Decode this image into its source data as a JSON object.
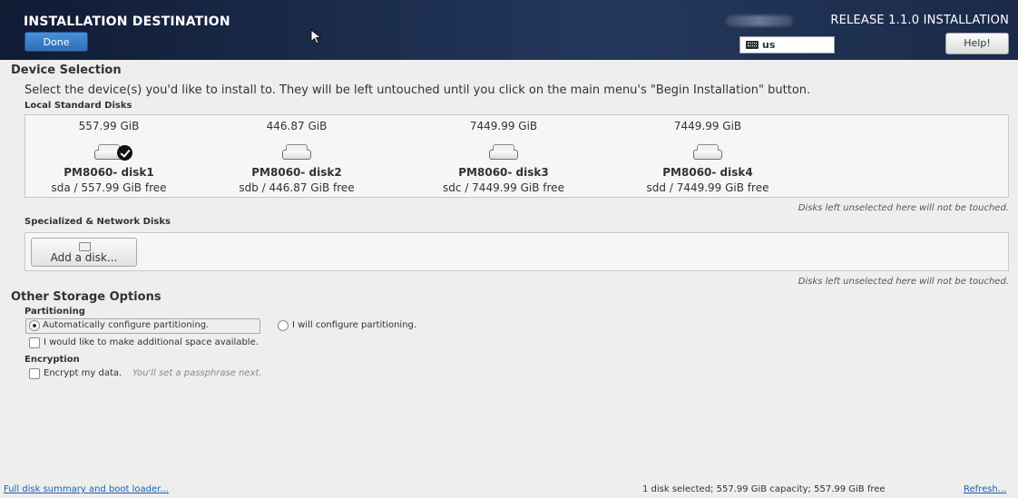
{
  "header": {
    "title": "INSTALLATION DESTINATION",
    "done_label": "Done",
    "release_title": "RELEASE 1.1.0 INSTALLATION",
    "keyboard_layout": "us",
    "help_label": "Help!"
  },
  "device_selection": {
    "heading": "Device Selection",
    "instruction": "Select the device(s) you'd like to install to.  They will be left untouched until you click on the main menu's \"Begin Installation\" button.",
    "local_disks_label": "Local Standard Disks",
    "disks": [
      {
        "size": "557.99 GiB",
        "name": "PM8060- disk1",
        "detail": "sda  /  557.99 GiB free",
        "selected": true
      },
      {
        "size": "446.87 GiB",
        "name": "PM8060- disk2",
        "detail": "sdb  /  446.87 GiB free",
        "selected": false
      },
      {
        "size": "7449.99 GiB",
        "name": "PM8060- disk3",
        "detail": "sdc  /  7449.99 GiB free",
        "selected": false
      },
      {
        "size": "7449.99 GiB",
        "name": "PM8060- disk4",
        "detail": "sdd  /  7449.99 GiB free",
        "selected": false
      }
    ],
    "local_note": "Disks left unselected here will not be touched.",
    "specialized_label": "Specialized & Network Disks",
    "add_disk_label": "Add a disk...",
    "specialized_note": "Disks left unselected here will not be touched."
  },
  "storage_options": {
    "heading": "Other Storage Options",
    "partitioning_label": "Partitioning",
    "auto_partition_label": "Automatically configure partitioning.",
    "auto_partition_selected": true,
    "manual_partition_label": "I will configure partitioning.",
    "manual_partition_selected": false,
    "additional_space_label": "I would like to make additional space available.",
    "additional_space_checked": false,
    "encryption_label": "Encryption",
    "encrypt_label": "Encrypt my data.",
    "encrypt_hint": "You'll set a passphrase next.",
    "encrypt_checked": false
  },
  "footer": {
    "summary_link": "Full disk summary and boot loader...",
    "selection_summary": "1 disk selected; 557.99 GiB capacity; 557.99 GiB free",
    "refresh_link": "Refresh..."
  }
}
